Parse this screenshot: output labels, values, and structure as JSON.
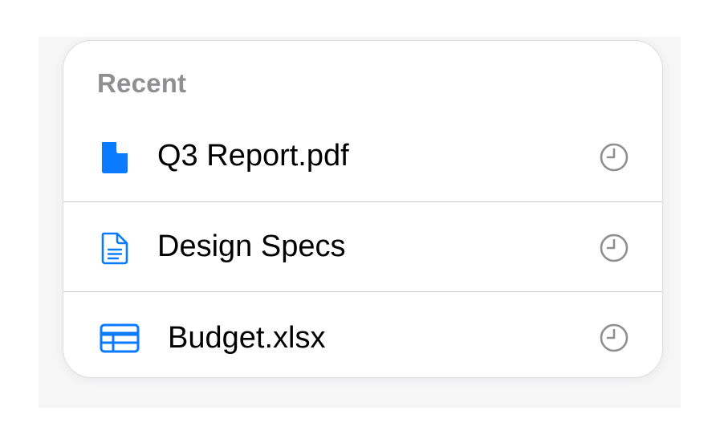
{
  "recent": {
    "title": "Recent",
    "items": [
      {
        "label": "Q3 Report.pdf",
        "icon": "pdf-document-icon"
      },
      {
        "label": "Design Specs",
        "icon": "text-document-icon"
      },
      {
        "label": "Budget.xlsx",
        "icon": "spreadsheet-icon"
      }
    ],
    "trailing_icon": "clock-icon"
  },
  "colors": {
    "accent": "#0a7aff",
    "header_text": "#8e8e93",
    "clock": "#8e8e93",
    "divider": "#c9c9cc"
  }
}
